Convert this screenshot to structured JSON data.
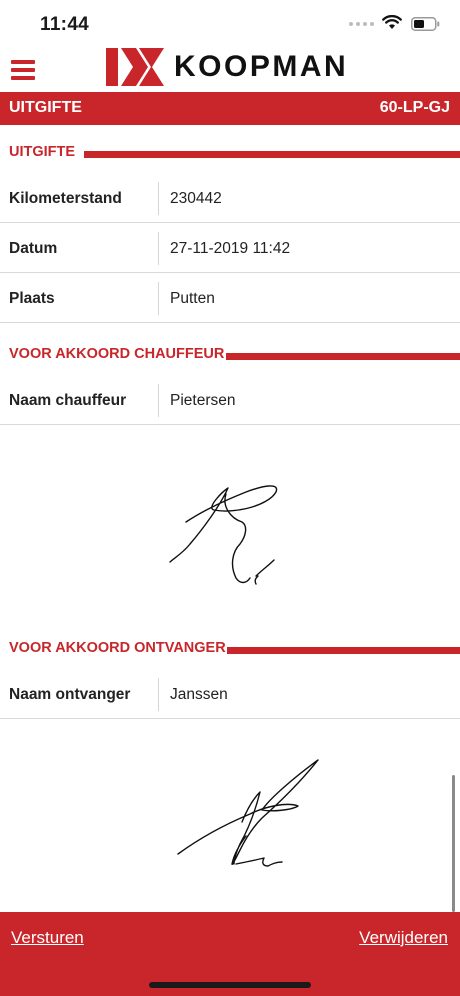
{
  "status_bar": {
    "time": "11:44"
  },
  "header": {
    "brand": "KOOPMAN"
  },
  "title_bar": {
    "left": "UITGIFTE",
    "right": "60-LP-GJ"
  },
  "sections": {
    "uitgifte": {
      "title": "UITGIFTE",
      "rows": [
        {
          "label": "Kilometerstand",
          "value": "230442"
        },
        {
          "label": "Datum",
          "value": "27-11-2019 11:42"
        },
        {
          "label": "Plaats",
          "value": "Putten"
        }
      ]
    },
    "chauffeur": {
      "title": "VOOR AKKOORD CHAUFFEUR",
      "rows": [
        {
          "label": "Naam chauffeur",
          "value": "Pietersen"
        }
      ]
    },
    "ontvanger": {
      "title": "VOOR AKKOORD ONTVANGER",
      "rows": [
        {
          "label": "Naam ontvanger",
          "value": "Janssen"
        }
      ]
    }
  },
  "footer": {
    "send_label": "Versturen",
    "delete_label": "Verwijderen"
  },
  "colors": {
    "brand_red": "#c8262a"
  }
}
